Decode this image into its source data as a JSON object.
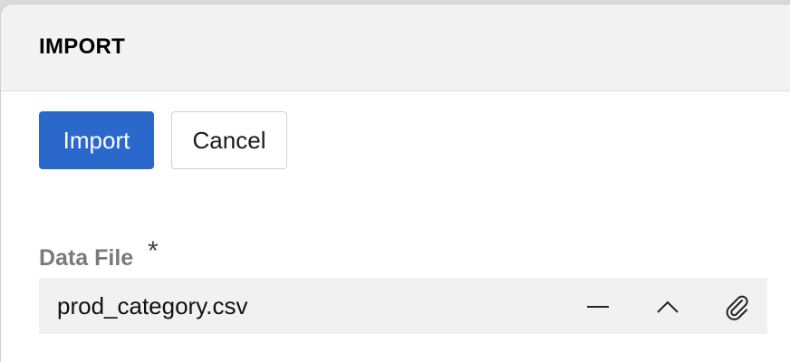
{
  "dialog": {
    "title": "IMPORT"
  },
  "toolbar": {
    "import_label": "Import",
    "cancel_label": "Cancel"
  },
  "data_file": {
    "label": "Data File",
    "required_marker": "*",
    "value": "prod_category.csv",
    "icons": [
      "minus-icon",
      "chevron-up-icon",
      "paperclip-icon"
    ]
  },
  "colors": {
    "primary": "#2a68cc",
    "header_bg": "#f3f3f3",
    "field_bg": "#f1f1f1",
    "label_gray": "#7a7a7a"
  }
}
